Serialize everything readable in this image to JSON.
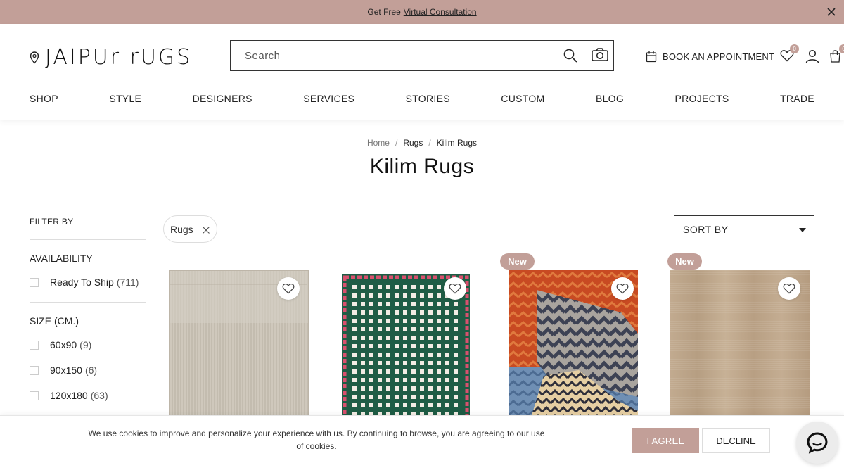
{
  "announcement": {
    "prefix": "Get Free",
    "link": "Virtual Consultation"
  },
  "brand": {
    "name": "JAIPUr rUGS"
  },
  "search": {
    "placeholder": "Search"
  },
  "header_actions": {
    "appointment": "BOOK AN APPOINTMENT",
    "wishlist_count": "0",
    "cart_count": "0"
  },
  "nav": [
    "SHOP",
    "STYLE",
    "DESIGNERS",
    "SERVICES",
    "STORIES",
    "CUSTOM",
    "BLOG",
    "PROJECTS",
    "TRADE"
  ],
  "breadcrumb": [
    "Home",
    "Rugs",
    "Kilim Rugs"
  ],
  "page_title": "Kilim Rugs",
  "filters": {
    "heading": "FILTER BY",
    "availability": {
      "title": "AVAILABILITY",
      "options": [
        {
          "label": "Ready To Ship",
          "count": "(711)"
        }
      ]
    },
    "size": {
      "title": "SIZE (CM.)",
      "options": [
        {
          "label": "60x90",
          "count": "(9)"
        },
        {
          "label": "90x150",
          "count": "(6)"
        },
        {
          "label": "120x180",
          "count": "(63)"
        }
      ]
    }
  },
  "active_chip": "Rugs",
  "sort": {
    "label": "SORT BY"
  },
  "products": [
    {
      "badge": ""
    },
    {
      "badge": ""
    },
    {
      "badge": "New"
    },
    {
      "badge": "New"
    }
  ],
  "colors": {
    "accent": "#c29f98"
  },
  "cookie": {
    "message": "We use cookies to improve and personalize your experience with us. By continuing to browse, you are agreeing to our use of cookies.",
    "agree": "I AGREE",
    "decline": "DECLINE"
  }
}
